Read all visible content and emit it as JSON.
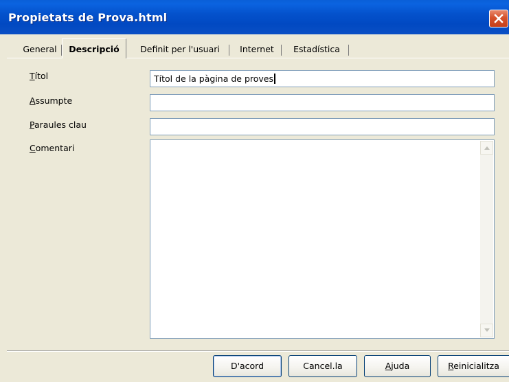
{
  "window": {
    "title": "Propietats de Prova.html"
  },
  "tabs": [
    {
      "label": "General",
      "active": false
    },
    {
      "label": "Descripció",
      "active": true
    },
    {
      "label": "Definit per l'usuari",
      "active": false
    },
    {
      "label": "Internet",
      "active": false
    },
    {
      "label": "Estadística",
      "active": false
    }
  ],
  "form": {
    "title": {
      "mnemonic": "T",
      "rest": "ítol",
      "value": "Títol de la pàgina de proves"
    },
    "subject": {
      "mnemonic": "A",
      "rest": "ssumpte",
      "value": ""
    },
    "keywords": {
      "mnemonic": "P",
      "rest": "araules clau",
      "value": ""
    },
    "comment": {
      "mnemonic": "C",
      "rest": "omentari",
      "value": ""
    }
  },
  "buttons": {
    "ok": "D'acord",
    "cancel": "Cancel.la",
    "help": {
      "mnemonic": "A",
      "rest": "juda"
    },
    "reset": {
      "mnemonic": "R",
      "rest": "einicialitza"
    }
  },
  "icons": {
    "close": "close-icon",
    "scroll_up": "arrow-up-icon",
    "scroll_down": "arrow-down-icon"
  },
  "colors": {
    "titlebar": "#0452cc",
    "close": "#d5522d",
    "face": "#ece9d8"
  }
}
